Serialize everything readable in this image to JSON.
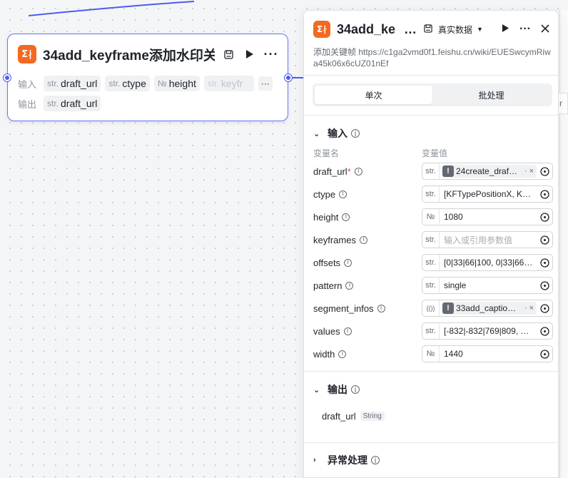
{
  "node": {
    "title": "34add_keyframe添加水印关…",
    "input_label": "输入",
    "output_label": "输出",
    "inputs": [
      {
        "type": "str.",
        "name": "draft_url"
      },
      {
        "type": "str.",
        "name": "ctype"
      },
      {
        "type": "№",
        "name": "height"
      },
      {
        "type": "str.",
        "name": "keyfr"
      }
    ],
    "more": "···",
    "outputs": [
      {
        "type": "str.",
        "name": "draft_url"
      }
    ]
  },
  "panel": {
    "title": "34add_ke",
    "title_ellipsis": "…",
    "mode_label": "真实数据",
    "description": "添加关键帧 https://c1ga2vmd0f1.feishu.cn/wiki/EUESwcymRiwa45k06x6cUZ01nEf",
    "tabs": [
      {
        "label": "单次",
        "active": true
      },
      {
        "label": "批处理",
        "active": false
      }
    ],
    "input_section": {
      "title": "输入",
      "col_name": "变量名",
      "col_value": "变量值",
      "params": [
        {
          "name": "draft_url",
          "required": true,
          "type": "str.",
          "kind": "ref",
          "value": "24create_draf…"
        },
        {
          "name": "ctype",
          "required": false,
          "type": "str.",
          "kind": "text",
          "value": "[KFTypePositionX, K…"
        },
        {
          "name": "height",
          "required": false,
          "type": "№",
          "kind": "text",
          "value": "1080"
        },
        {
          "name": "keyframes",
          "required": false,
          "type": "str.",
          "kind": "placeholder",
          "value": "输入或引用参数值"
        },
        {
          "name": "offsets",
          "required": false,
          "type": "str.",
          "kind": "text",
          "value": "[0|33|66|100, 0|33|66…"
        },
        {
          "name": "pattern",
          "required": false,
          "type": "str.",
          "kind": "text",
          "value": "single"
        },
        {
          "name": "segment_infos",
          "required": false,
          "type": "{()}",
          "kind": "ref",
          "value": "33add_captio…"
        },
        {
          "name": "values",
          "required": false,
          "type": "str.",
          "kind": "text",
          "value": "[-832|-832|769|809, …"
        },
        {
          "name": "width",
          "required": false,
          "type": "№",
          "kind": "text",
          "value": "1440"
        }
      ]
    },
    "output_section": {
      "title": "输出",
      "items": [
        {
          "name": "draft_url",
          "type": "String"
        }
      ]
    },
    "error_section": {
      "title": "异常处理"
    }
  },
  "colors": {
    "accent": "#4e5bf0",
    "logo": "#f26a21"
  }
}
